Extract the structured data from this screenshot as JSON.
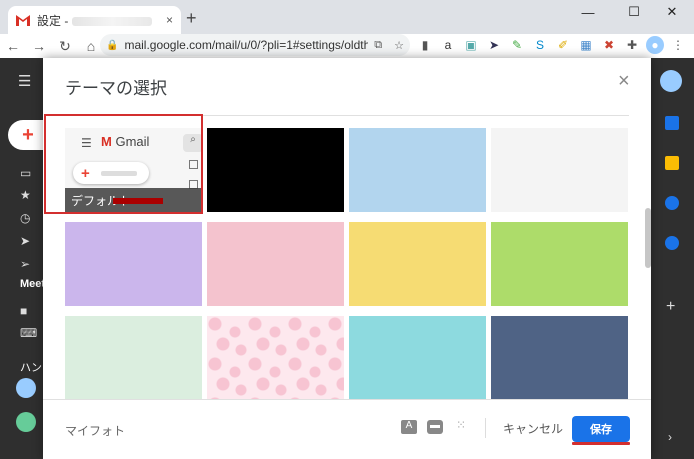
{
  "browser": {
    "tab_title": "設定 - ",
    "tab_close": "×",
    "new_tab": "+",
    "win_min": "—",
    "win_max": "☐",
    "win_close": "✕",
    "back": "←",
    "forward": "→",
    "reload": "↻",
    "home": "⌂",
    "url": "mail.google.com/mail/u/0/?pli=1#settings/oldthe...",
    "menu": "⋮"
  },
  "gmail": {
    "meet_label": "Meet",
    "hangouts_label": "ハン",
    "compose_plus": "+"
  },
  "modal": {
    "title": "テーマの選択",
    "close": "×",
    "default_logo_m": "M",
    "default_logo_text": "Gmail",
    "default_label": "デフォルト",
    "footer": {
      "my_photo": "マイフォト",
      "text_icon": "A",
      "cancel": "キャンセル",
      "save": "保存"
    }
  },
  "themes": [
    {
      "name": "default",
      "color": "#f6f6f6"
    },
    {
      "name": "black",
      "color": "#000000"
    },
    {
      "name": "light-blue",
      "color": "#b2d5ee"
    },
    {
      "name": "light-gray",
      "color": "#f4f4f4"
    },
    {
      "name": "lavender",
      "color": "#cbb6ec"
    },
    {
      "name": "pink",
      "color": "#f4c3ce"
    },
    {
      "name": "yellow",
      "color": "#f6dc73"
    },
    {
      "name": "green",
      "color": "#addc6a"
    },
    {
      "name": "mint",
      "color": "#dbeedf"
    },
    {
      "name": "sakura",
      "color": "#fde8ee"
    },
    {
      "name": "cyan",
      "color": "#8ddadf"
    },
    {
      "name": "slate-blue",
      "color": "#4f6385"
    }
  ]
}
